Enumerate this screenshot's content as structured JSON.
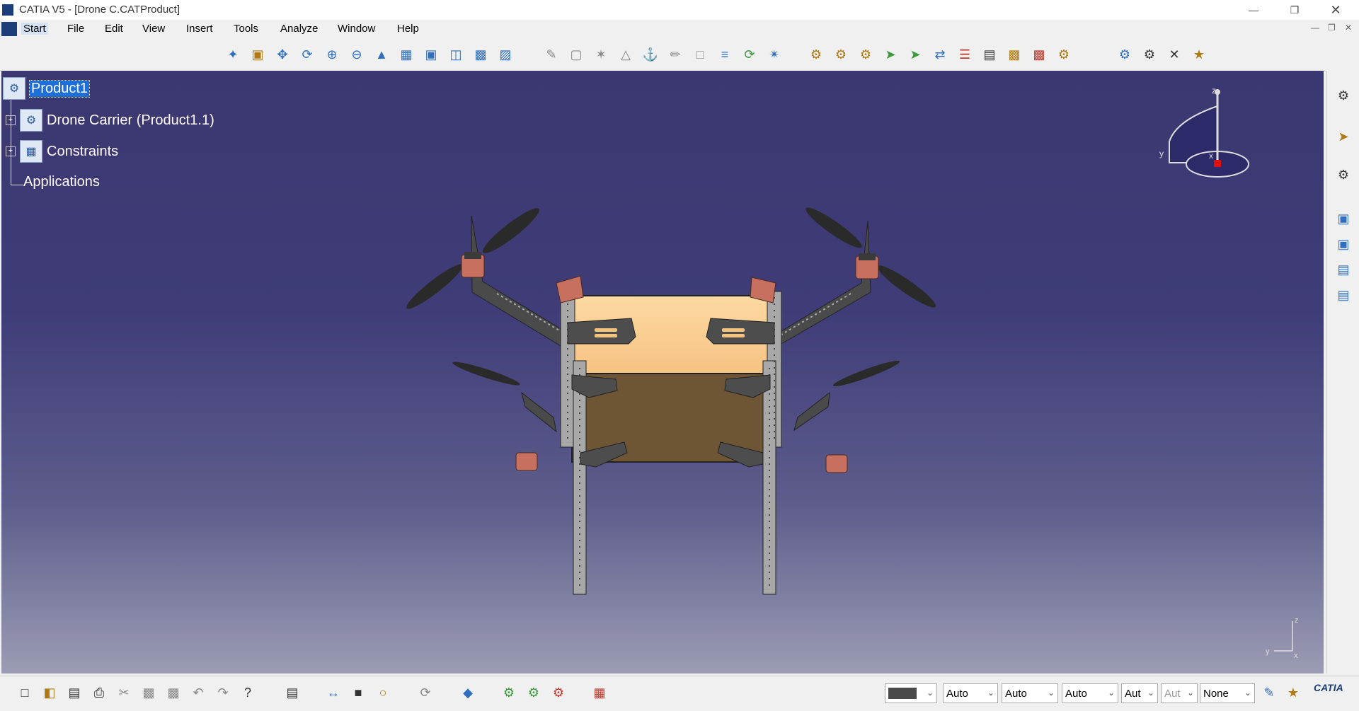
{
  "window": {
    "title": "CATIA V5 - [Drone C.CATProduct]"
  },
  "menus": [
    "Start",
    "File",
    "Edit",
    "View",
    "Insert",
    "Tools",
    "Analyze",
    "Window",
    "Help"
  ],
  "tree": {
    "root": "Product1",
    "children": [
      {
        "label": "Drone Carrier (Product1.1)"
      },
      {
        "label": "Constraints"
      },
      {
        "label": "Applications"
      }
    ]
  },
  "compass": {
    "z": "z",
    "y": "y",
    "x": "x"
  },
  "axis": {
    "z": "z",
    "y": "y",
    "x": "x"
  },
  "bottom_props": {
    "color_value": "",
    "transparency": "Auto",
    "linetype": "Auto",
    "thickness": "Auto",
    "point_symbol": "Aut",
    "layer_disabled": "Aut",
    "layer": "None"
  },
  "brand": "CATIA",
  "colors": {
    "accent": "#1e6fd8",
    "box_top": "#fbd196",
    "box_side": "#6e5535",
    "motor": "#c87060"
  }
}
